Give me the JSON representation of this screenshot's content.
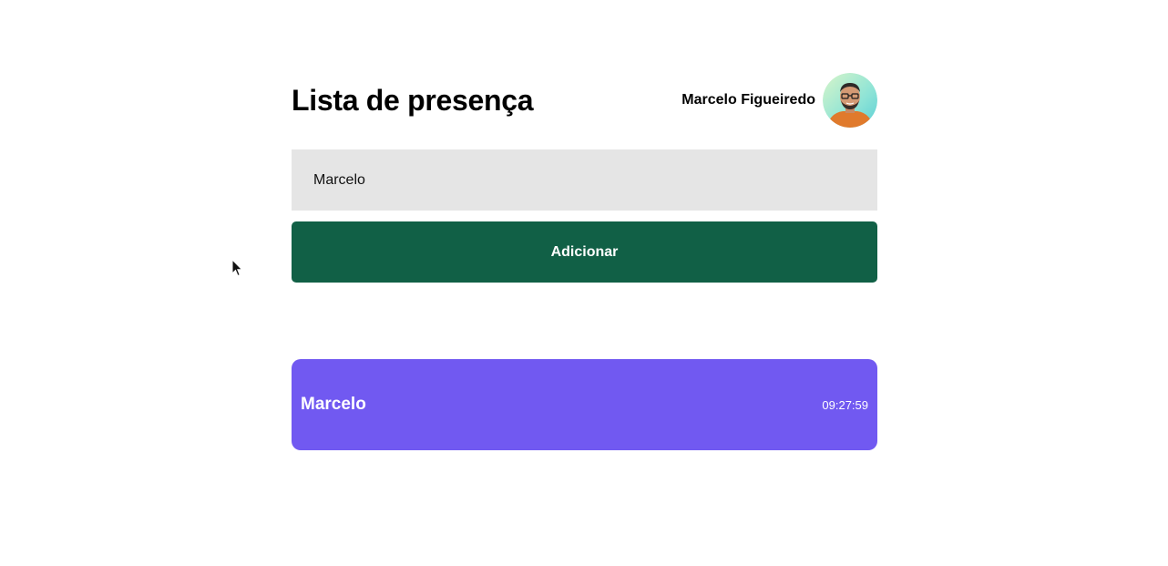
{
  "header": {
    "title": "Lista de presença",
    "user_name": "Marcelo Figueiredo"
  },
  "form": {
    "input_value": "Marcelo",
    "add_button_label": "Adicionar"
  },
  "attendees": [
    {
      "name": "Marcelo",
      "time": "09:27:59"
    }
  ],
  "colors": {
    "primary_button": "#116046",
    "card_background": "#7159f1",
    "input_background": "#e5e5e5"
  }
}
